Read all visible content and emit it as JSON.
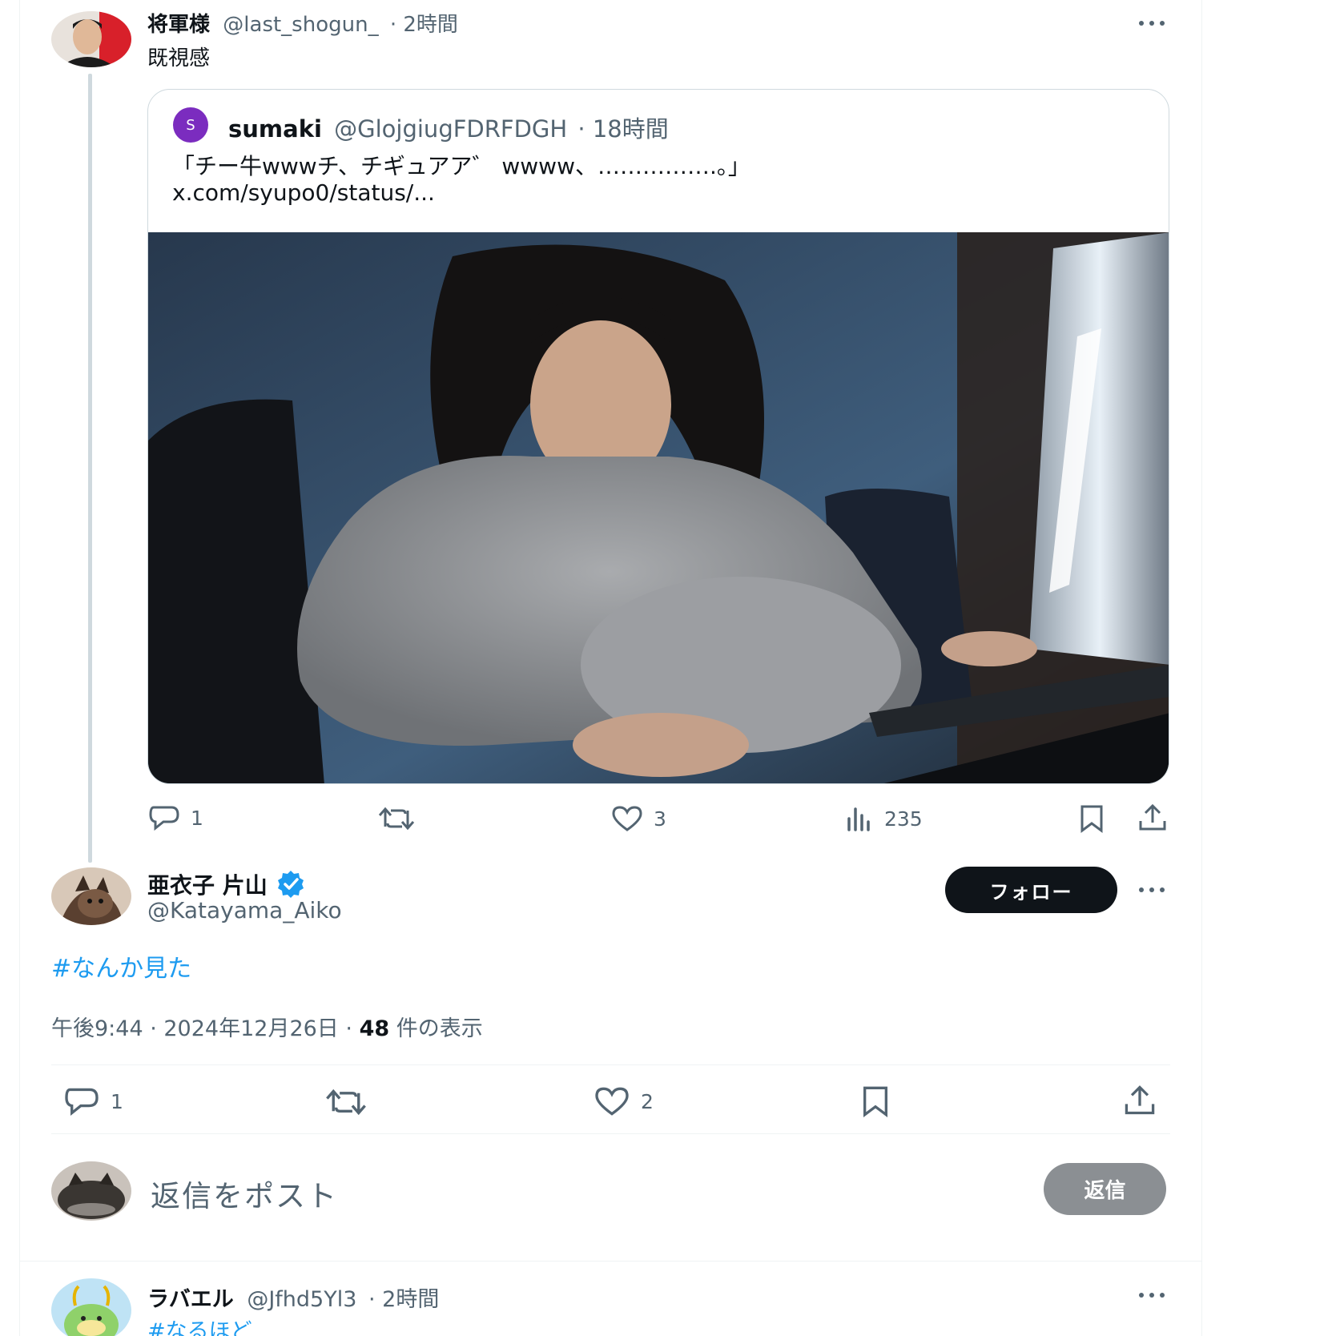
{
  "quote_post": {
    "author_name": "将軍様",
    "author_handle": "@last_shogun_",
    "time": "· 2時間",
    "text": "既視感",
    "quoted": {
      "avatar_letter": "S",
      "author_name": "sumaki",
      "author_handle": "@GlojgiugFDRFDGH",
      "time": "· 18時間",
      "text_line1": "「チー牛wwwチ、チギュアア゛ wwww、…………….。」",
      "text_line2": "x.com/syupo0/status/..."
    },
    "actions": {
      "reply_count": "1",
      "repost_count": "",
      "like_count": "3",
      "views_count": "235"
    }
  },
  "main_post": {
    "author_name": "亜衣子 片山",
    "author_handle": "@Katayama_Aiko",
    "follow_label": "フォロー",
    "hashtag": "#なんか見た",
    "timestamp": "午後9:44 · 2024年12月26日 · ",
    "views_number": "48",
    "views_label": " 件の表示",
    "actions": {
      "reply_count": "1",
      "repost_count": "",
      "like_count": "2"
    }
  },
  "composer": {
    "placeholder": "返信をポスト",
    "reply_label": "返信"
  },
  "next_post": {
    "author_name": "ラバエル",
    "author_handle": "@Jfhd5Yl3",
    "time": "· 2時間",
    "hashtag": "#なるほど"
  },
  "colors": {
    "accent": "#1d9bf0",
    "verified": "#1d9bf0",
    "quoted_avatar": "#7b2cbf",
    "text_primary": "#0f1419",
    "text_muted": "#536471"
  }
}
